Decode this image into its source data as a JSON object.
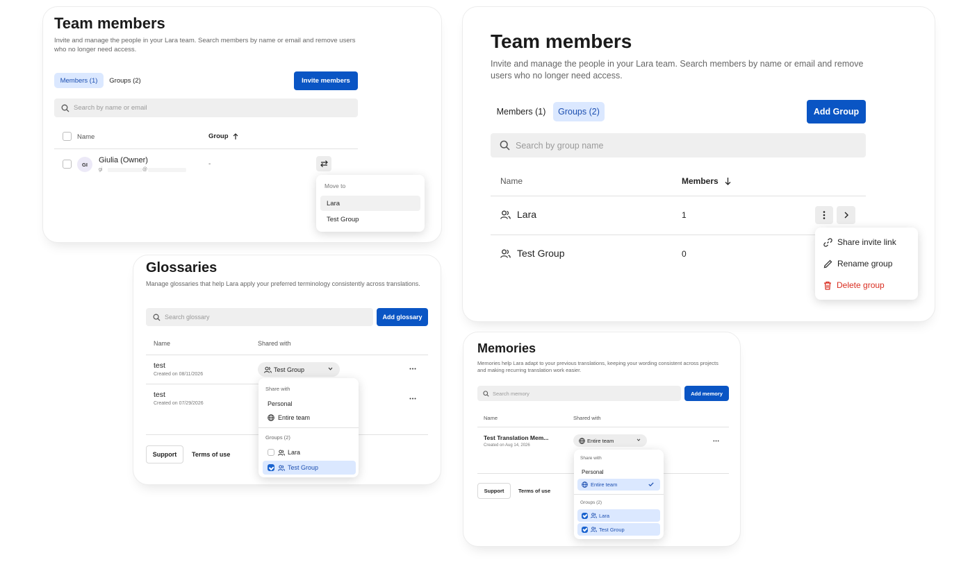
{
  "team1": {
    "title": "Team members",
    "description": "Invite and manage the people in your Lara team. Search members by name or email and remove users who no longer need access.",
    "tabs": [
      {
        "label": "Members (1)",
        "active": true
      },
      {
        "label": "Groups (2)",
        "active": false
      }
    ],
    "invite_button": "Invite members",
    "search_placeholder": "Search by name or email",
    "columns": {
      "name": "Name",
      "group": "Group"
    },
    "row": {
      "initials": "GI",
      "name": "Giulia (Owner)",
      "email_prefix": "gi",
      "email_at": "@",
      "group": "-"
    },
    "move_menu": {
      "title": "Move to",
      "items": [
        "Lara",
        "Test Group"
      ]
    }
  },
  "team2": {
    "title": "Team members",
    "description": "Invite and manage the people in your Lara team. Search members by name or email and remove users who no longer need access.",
    "tabs": [
      {
        "label": "Members (1)",
        "active": false
      },
      {
        "label": "Groups (2)",
        "active": true
      }
    ],
    "add_button": "Add Group",
    "search_placeholder": "Search by group name",
    "columns": {
      "name": "Name",
      "members": "Members"
    },
    "rows": [
      {
        "name": "Lara",
        "members": "1"
      },
      {
        "name": "Test Group",
        "members": "0"
      }
    ],
    "actions_menu": {
      "share": "Share invite link",
      "rename": "Rename group",
      "delete": "Delete group"
    }
  },
  "glossaries": {
    "title": "Glossaries",
    "description": "Manage glossaries that help Lara apply your preferred terminology consistently across translations.",
    "search_placeholder": "Search glossary",
    "add_button": "Add glossary",
    "columns": {
      "name": "Name",
      "shared": "Shared with"
    },
    "rows": [
      {
        "name": "test",
        "created": "Created on 08/11/2026",
        "shared": "Test Group"
      },
      {
        "name": "test",
        "created": "Created on 07/29/2026"
      }
    ],
    "dropdown": {
      "share_with": "Share with",
      "personal": "Personal",
      "entire_team": "Entire team",
      "groups_header": "Groups (2)",
      "groups": [
        "Lara",
        "Test Group"
      ]
    },
    "footer": {
      "support": "Support",
      "terms": "Terms of use"
    }
  },
  "memories": {
    "title": "Memories",
    "description": "Memories help Lara adapt to your previous translations, keeping your wording consistent across projects and making recurring translation work easier.",
    "search_placeholder": "Search memory",
    "add_button": "Add memory",
    "columns": {
      "name": "Name",
      "shared": "Shared with"
    },
    "row": {
      "name": "Test Translation Mem...",
      "created": "Created on Aug 14, 2026",
      "shared": "Entire team"
    },
    "dropdown": {
      "share_with": "Share with",
      "personal": "Personal",
      "entire_team": "Entire team",
      "groups_header": "Groups (2)",
      "groups": [
        "Lara",
        "Test Group"
      ]
    },
    "footer": {
      "support": "Support",
      "terms": "Terms of use"
    }
  },
  "colors": {
    "accent": "#0a55c4",
    "selection": "#dbe8ff",
    "danger": "#d92d20"
  }
}
